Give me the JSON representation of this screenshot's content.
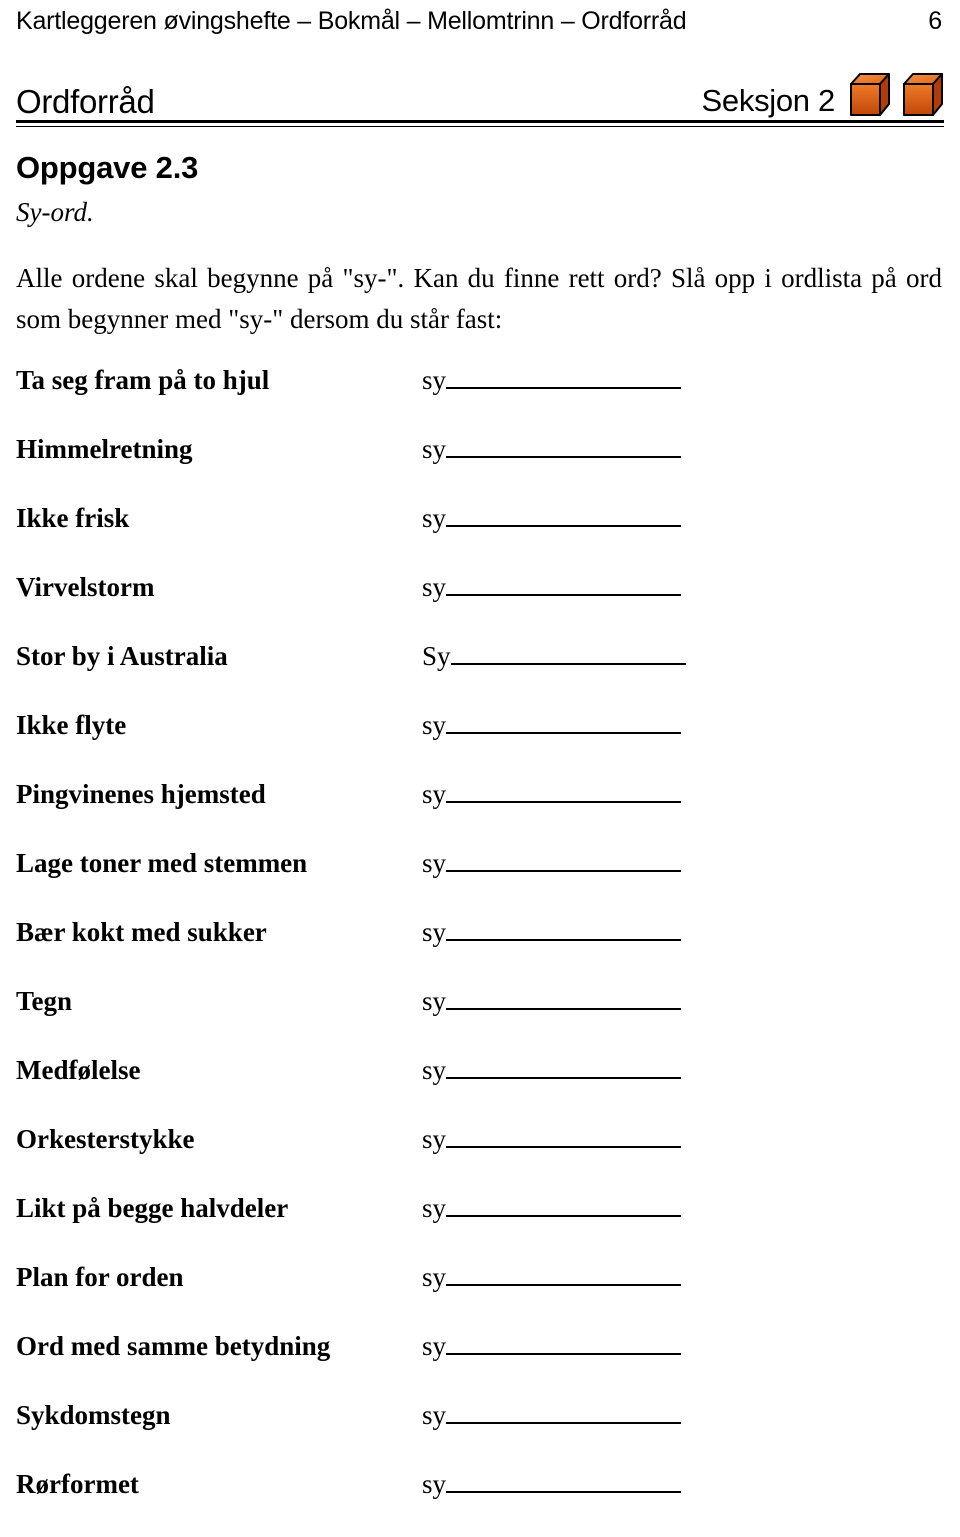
{
  "running_head": {
    "title": "Kartleggeren øvingshefte – Bokmål – Mellomtrinn – Ordforråd",
    "page_number": "6"
  },
  "section_header": {
    "subject": "Ordforråd",
    "section_label": "Seksjon 2",
    "cube_icons": [
      "cube-icon",
      "cube-icon"
    ],
    "colors": {
      "cube_top": "#f07d28",
      "cube_front_light": "#e2641a",
      "cube_front_dark": "#c5470c",
      "cube_side": "#b33f08",
      "cube_outline": "#000000",
      "rule": "#000000"
    }
  },
  "exercise": {
    "title": "Oppgave 2.3",
    "subtitle": "Sy-ord.",
    "instructions": "Alle ordene skal begynne på \"sy-\". Kan du finne rett ord? Slå opp i ordlista på ord som begynner med \"sy-\" dersom du står fast:"
  },
  "word_list": {
    "rows": [
      {
        "clue": "Ta seg fram på to hjul",
        "prefix": "sy"
      },
      {
        "clue": "Himmelretning",
        "prefix": "sy"
      },
      {
        "clue": "Ikke frisk",
        "prefix": "sy"
      },
      {
        "clue": "Virvelstorm",
        "prefix": "sy"
      },
      {
        "clue": "Stor by i Australia",
        "prefix": "Sy"
      },
      {
        "clue": "Ikke flyte",
        "prefix": "sy"
      },
      {
        "clue": "Pingvinenes hjemsted",
        "prefix": "sy"
      },
      {
        "clue": "Lage toner med stemmen",
        "prefix": "sy"
      },
      {
        "clue": "Bær kokt med sukker",
        "prefix": "sy"
      },
      {
        "clue": "Tegn",
        "prefix": "sy"
      },
      {
        "clue": "Medfølelse",
        "prefix": "sy"
      },
      {
        "clue": "Orkesterstykke",
        "prefix": "sy"
      },
      {
        "clue": "Likt på begge halvdeler",
        "prefix": "sy"
      },
      {
        "clue": "Plan for orden",
        "prefix": "sy"
      },
      {
        "clue": "Ord med samme betydning",
        "prefix": "sy"
      },
      {
        "clue": "Sykdomstegn",
        "prefix": "sy"
      },
      {
        "clue": "Rørformet",
        "prefix": "sy"
      }
    ]
  }
}
